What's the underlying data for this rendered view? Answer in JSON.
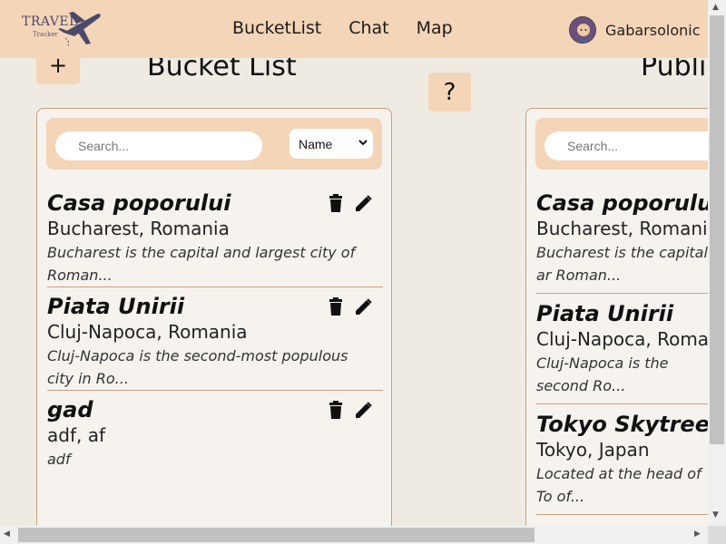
{
  "app": {
    "logo_text": "TRAVEL",
    "logo_sub": "Tracker"
  },
  "nav": {
    "links": [
      "BucketList",
      "Chat",
      "Map"
    ],
    "username": "Gabarsolonic"
  },
  "buttons": {
    "add_label": "+",
    "help_label": "?"
  },
  "bucket_list": {
    "title": "Bucket List",
    "search_placeholder": "Search...",
    "sort_selected": "Name",
    "items": [
      {
        "name": "Casa poporului",
        "location": "Bucharest, Romania",
        "description": "Bucharest is the capital and largest city of Roman..."
      },
      {
        "name": "Piata Unirii",
        "location": "Cluj-Napoca, Romania",
        "description": "Cluj-Napoca is the second-most populous city in Ro..."
      },
      {
        "name": "gad",
        "location": "adf, af",
        "description": "adf"
      }
    ]
  },
  "public_list": {
    "title": "Public",
    "search_placeholder": "Search...",
    "items": [
      {
        "name": "Casa poporului",
        "location": "Bucharest, Romania",
        "description": "Bucharest is the capital ar Roman..."
      },
      {
        "name": "Piata Unirii",
        "location": "Cluj-Napoca, Roman",
        "description": "Cluj-Napoca is the second Ro..."
      },
      {
        "name": "Tokyo Skytree",
        "location": "Tokyo, Japan",
        "description": "Located at the head of To of..."
      }
    ]
  },
  "colors": {
    "navbar": "#f5d5b7",
    "background": "#efebe2",
    "panel": "#f6f3ef",
    "border": "#c9a07b"
  }
}
